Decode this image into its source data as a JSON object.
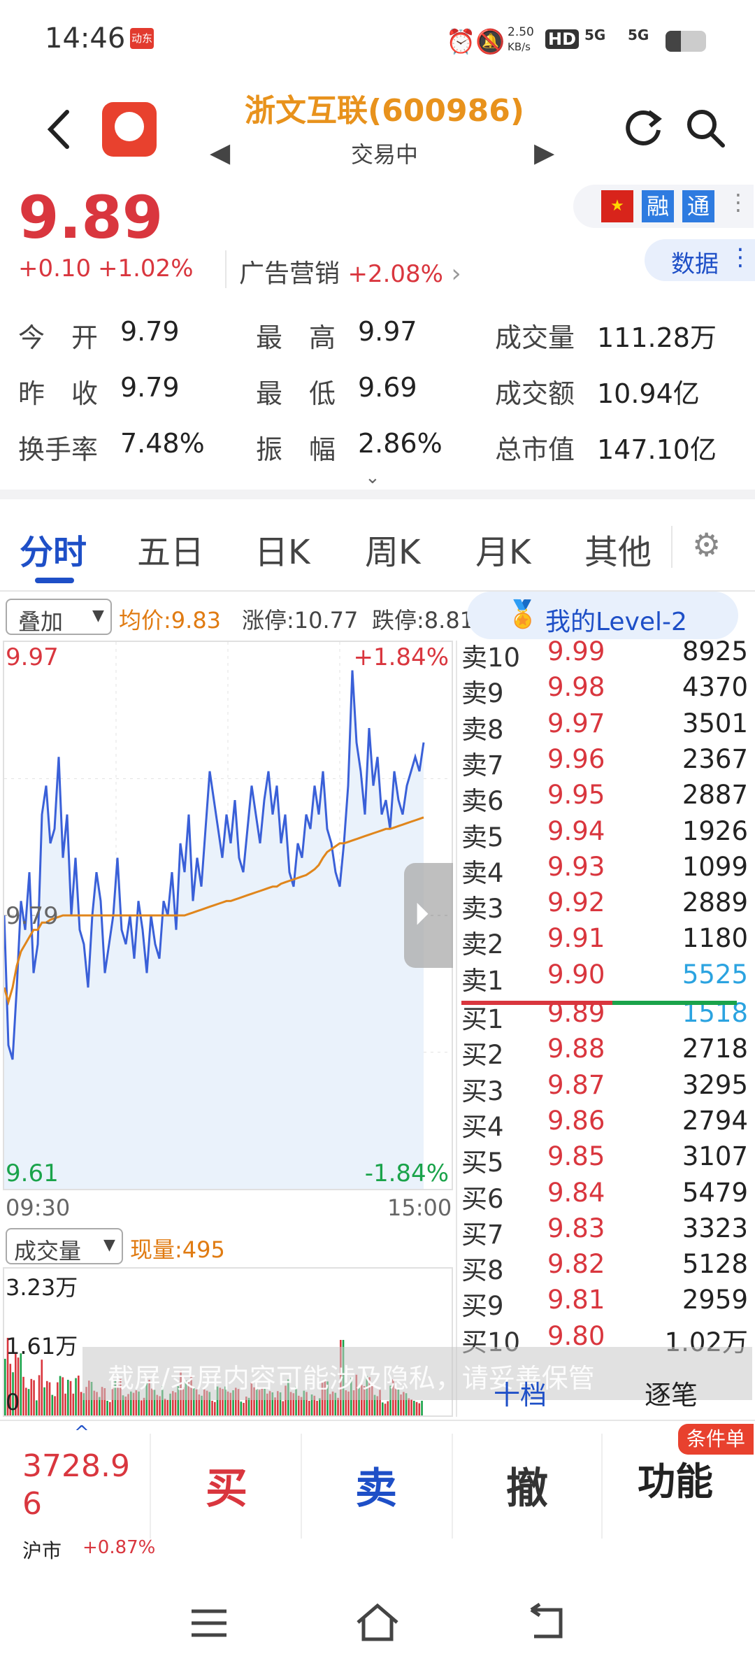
{
  "status": {
    "time": "14:46",
    "app_badge": "动东",
    "net_speed": "2.50",
    "net_unit": "KB/s",
    "hd": "HD",
    "sig1": "5G",
    "sig2": "5G"
  },
  "header": {
    "title": "浙文互联(600986)",
    "subtitle": "交易中"
  },
  "quote": {
    "price": "9.89",
    "change": "+0.10",
    "change_pct": "+1.02%",
    "sector": "广告营销",
    "sector_pct": "+2.08%",
    "badge_rong": "融",
    "badge_tong": "通",
    "data_btn": "数据"
  },
  "stats": [
    {
      "label": "今　开",
      "value": "9.79"
    },
    {
      "label": "最　高",
      "value": "9.97"
    },
    {
      "label": "成交量",
      "value": "111.28万"
    },
    {
      "label": "昨　收",
      "value": "9.79"
    },
    {
      "label": "最　低",
      "value": "9.69"
    },
    {
      "label": "成交额",
      "value": "10.94亿"
    },
    {
      "label": "换手率",
      "value": "7.48%"
    },
    {
      "label": "振　幅",
      "value": "2.86%"
    },
    {
      "label": "总市值",
      "value": "147.10亿"
    }
  ],
  "tabs": [
    "分时",
    "五日",
    "日K",
    "周K",
    "月K",
    "其他"
  ],
  "chart_bar": {
    "overlay": "叠加",
    "avg": "均价:9.83",
    "limit_up": "涨停:10.77",
    "limit_down": "跌停:8.81",
    "level2": "我的Level-2"
  },
  "chart_data": {
    "type": "line",
    "y_max_label": "9.97",
    "y_min_label": "9.61",
    "y_mid_label": "9.79",
    "pct_max": "+1.84%",
    "pct_min": "-1.84%",
    "x_start": "09:30",
    "x_end": "15:00",
    "ylim": [
      9.61,
      9.97
    ],
    "series": [
      {
        "values": [
          9.79,
          9.7,
          9.69,
          9.74,
          9.8,
          9.78,
          9.82,
          9.75,
          9.77,
          9.86,
          9.88,
          9.84,
          9.85,
          9.9,
          9.83,
          9.86,
          9.79,
          9.83,
          9.78,
          9.77,
          9.74,
          9.79,
          9.82,
          9.8,
          9.75,
          9.77,
          9.79,
          9.83,
          9.78,
          9.77,
          9.79,
          9.76,
          9.8,
          9.78,
          9.75,
          9.79,
          9.77,
          9.76,
          9.8,
          9.79,
          9.82,
          9.78,
          9.84,
          9.82,
          9.86,
          9.8,
          9.83,
          9.81,
          9.85,
          9.89,
          9.87,
          9.85,
          9.83,
          9.86,
          9.84,
          9.87,
          9.83,
          9.82,
          9.85,
          9.88,
          9.86,
          9.84,
          9.87,
          9.89,
          9.86,
          9.88,
          9.84,
          9.86,
          9.82,
          9.81,
          9.84,
          9.83,
          9.86,
          9.85,
          9.88,
          9.86,
          9.89,
          9.85,
          9.84,
          9.82,
          9.81,
          9.84,
          9.88,
          9.96,
          9.91,
          9.89,
          9.86,
          9.92,
          9.88,
          9.9,
          9.86,
          9.87,
          9.85,
          9.89,
          9.87,
          9.86,
          9.88,
          9.89,
          9.9,
          9.89,
          9.91
        ]
      },
      {
        "values": [
          9.74,
          9.73,
          9.74,
          9.755,
          9.765,
          9.77,
          9.775,
          9.78,
          9.78,
          9.785,
          9.785,
          9.787,
          9.788,
          9.789,
          9.79,
          9.79,
          9.79,
          9.79,
          9.79,
          9.79,
          9.79,
          9.79,
          9.79,
          9.79,
          9.79,
          9.79,
          9.79,
          9.79,
          9.79,
          9.79,
          9.79,
          9.79,
          9.79,
          9.79,
          9.79,
          9.79,
          9.79,
          9.79,
          9.79,
          9.79,
          9.79,
          9.79,
          9.79,
          9.79,
          9.791,
          9.792,
          9.793,
          9.794,
          9.795,
          9.796,
          9.797,
          9.798,
          9.799,
          9.8,
          9.8,
          9.801,
          9.802,
          9.803,
          9.804,
          9.805,
          9.806,
          9.807,
          9.808,
          9.809,
          9.81,
          9.81,
          9.812,
          9.813,
          9.814,
          9.815,
          9.816,
          9.817,
          9.818,
          9.82,
          9.822,
          9.825,
          9.83,
          9.834,
          9.836,
          9.838,
          9.84,
          9.84,
          9.841,
          9.842,
          9.843,
          9.844,
          9.845,
          9.846,
          9.847,
          9.848,
          9.849,
          9.85,
          9.85,
          9.851,
          9.852,
          9.853,
          9.854,
          9.855,
          9.856,
          9.857,
          9.858
        ]
      }
    ]
  },
  "volume_bar": {
    "select": "成交量",
    "now": "现量:495",
    "max": "3.23万",
    "mid": "1.61万",
    "zero": "0"
  },
  "order_book": [
    {
      "label": "卖10",
      "price": "9.99",
      "vol": "8925"
    },
    {
      "label": "卖9",
      "price": "9.98",
      "vol": "4370"
    },
    {
      "label": "卖8",
      "price": "9.97",
      "vol": "3501"
    },
    {
      "label": "卖7",
      "price": "9.96",
      "vol": "2367"
    },
    {
      "label": "卖6",
      "price": "9.95",
      "vol": "2887"
    },
    {
      "label": "卖5",
      "price": "9.94",
      "vol": "1926"
    },
    {
      "label": "卖4",
      "price": "9.93",
      "vol": "1099"
    },
    {
      "label": "卖3",
      "price": "9.92",
      "vol": "2889"
    },
    {
      "label": "卖2",
      "price": "9.91",
      "vol": "1180"
    },
    {
      "label": "卖1",
      "price": "9.90",
      "vol": "5525"
    },
    {
      "label": "买1",
      "price": "9.89",
      "vol": "1518"
    },
    {
      "label": "买2",
      "price": "9.88",
      "vol": "2718"
    },
    {
      "label": "买3",
      "price": "9.87",
      "vol": "3295"
    },
    {
      "label": "买4",
      "price": "9.86",
      "vol": "2794"
    },
    {
      "label": "买5",
      "price": "9.85",
      "vol": "3107"
    },
    {
      "label": "买6",
      "price": "9.84",
      "vol": "5479"
    },
    {
      "label": "买7",
      "price": "9.83",
      "vol": "3323"
    },
    {
      "label": "买8",
      "price": "9.82",
      "vol": "5128"
    },
    {
      "label": "买9",
      "price": "9.81",
      "vol": "2959"
    },
    {
      "label": "买10",
      "price": "9.80",
      "vol": "1.02万"
    }
  ],
  "ob_tabs": {
    "ten": "十档",
    "trade": "逐笔"
  },
  "watermark": "截屏/录屏内容可能涉及隐私，请妥善保管",
  "bottom": {
    "index_value": "3728.96",
    "index_name": "沪市",
    "index_pct": "+0.87%",
    "buy": "买",
    "sell": "卖",
    "cancel": "撤",
    "func": "功能",
    "cond": "条件单"
  }
}
